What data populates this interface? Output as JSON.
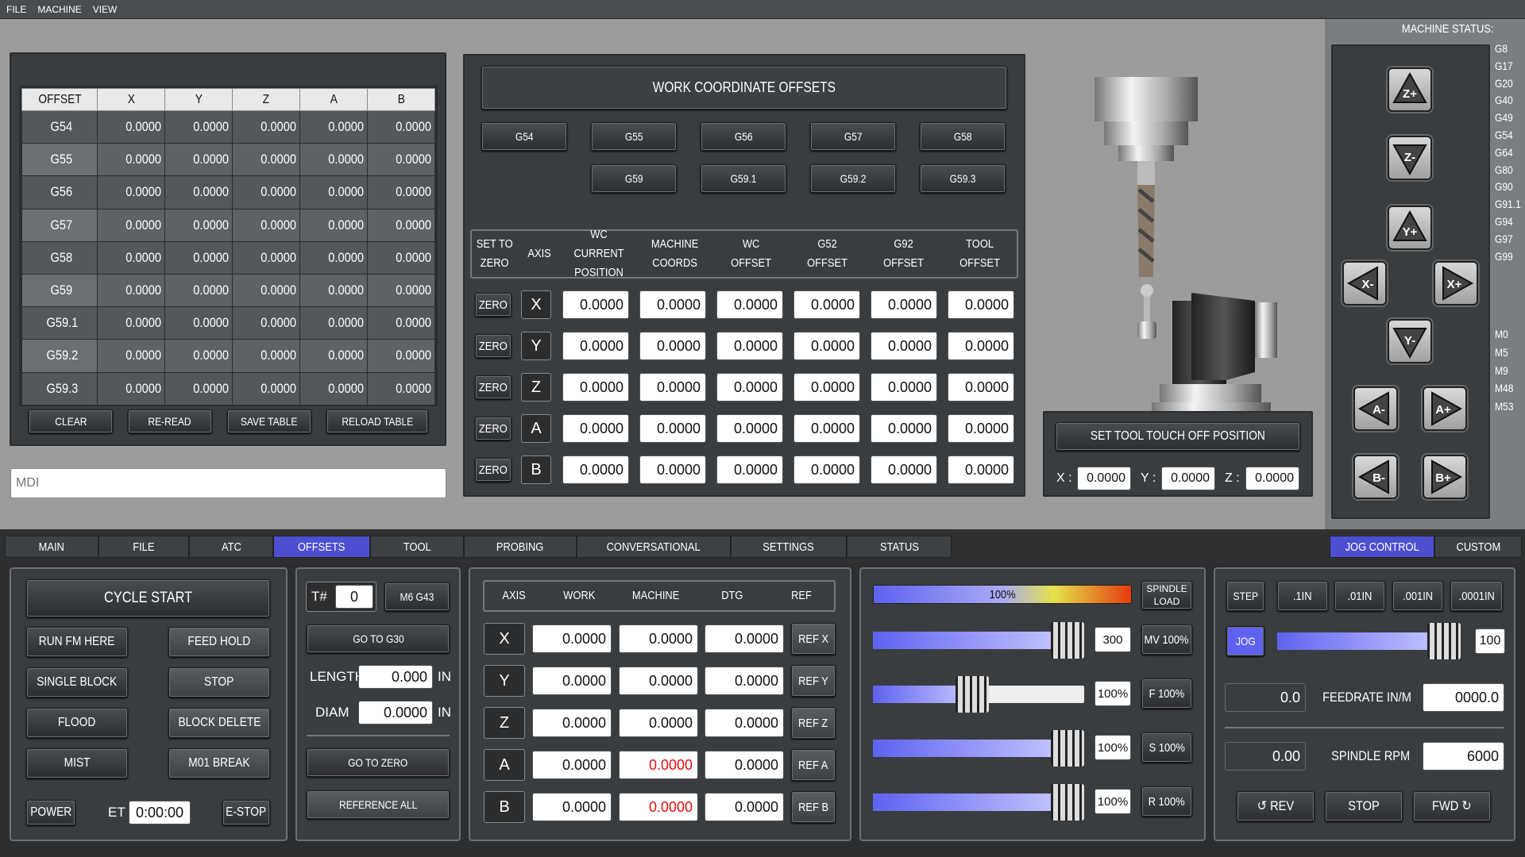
{
  "menu": [
    "FILE",
    "MACHINE",
    "VIEW"
  ],
  "offset_table": {
    "headers": [
      "OFFSET",
      "X",
      "Y",
      "Z",
      "A",
      "B"
    ],
    "rows": [
      [
        "G54",
        "0.0000",
        "0.0000",
        "0.0000",
        "0.0000",
        "0.0000"
      ],
      [
        "G55",
        "0.0000",
        "0.0000",
        "0.0000",
        "0.0000",
        "0.0000"
      ],
      [
        "G56",
        "0.0000",
        "0.0000",
        "0.0000",
        "0.0000",
        "0.0000"
      ],
      [
        "G57",
        "0.0000",
        "0.0000",
        "0.0000",
        "0.0000",
        "0.0000"
      ],
      [
        "G58",
        "0.0000",
        "0.0000",
        "0.0000",
        "0.0000",
        "0.0000"
      ],
      [
        "G59",
        "0.0000",
        "0.0000",
        "0.0000",
        "0.0000",
        "0.0000"
      ],
      [
        "G59.1",
        "0.0000",
        "0.0000",
        "0.0000",
        "0.0000",
        "0.0000"
      ],
      [
        "G59.2",
        "0.0000",
        "0.0000",
        "0.0000",
        "0.0000",
        "0.0000"
      ],
      [
        "G59.3",
        "0.0000",
        "0.0000",
        "0.0000",
        "0.0000",
        "0.0000"
      ]
    ],
    "buttons": [
      "CLEAR",
      "RE-READ",
      "SAVE TABLE",
      "RELOAD TABLE"
    ]
  },
  "mdi_placeholder": "MDI",
  "wco": {
    "title": "WORK COORDINATE OFFSETS",
    "row1": [
      "G54",
      "G55",
      "G56",
      "G57",
      "G58"
    ],
    "row2": [
      "G59",
      "G59.1",
      "G59.2",
      "G59.3"
    ],
    "headers": [
      "SET TO\nZERO",
      "AXIS",
      "WC CURRENT\nPOSITION",
      "MACHINE\nCOORDS",
      "WC\nOFFSET",
      "G52\nOFFSET",
      "G92\nOFFSET",
      "TOOL\nOFFSET"
    ],
    "zero_label": "ZERO",
    "axes": [
      "X",
      "Y",
      "Z",
      "A",
      "B"
    ],
    "value": "0.0000"
  },
  "touch_off": {
    "button": "SET TOOL TOUCH OFF POSITION",
    "x_label": "X :",
    "x": "0.0000",
    "y_label": "Y :",
    "y": "0.0000",
    "z_label": "Z :",
    "z": "0.0000"
  },
  "machine_status": {
    "label": "MACHINE STATUS:",
    "gcodes": [
      "G8",
      "G17",
      "G20",
      "G40",
      "G49",
      "G54",
      "G64",
      "G80",
      "G90",
      "G91.1",
      "G94",
      "G97",
      "G99"
    ],
    "mcodes": [
      "M0",
      "M5",
      "M9",
      "M48",
      "M53"
    ]
  },
  "jog_buttons": [
    "Z+",
    "Z-",
    "Y+",
    "X-",
    "X+",
    "Y-",
    "A-",
    "A+",
    "B-",
    "B+"
  ],
  "tabs": [
    "MAIN",
    "FILE",
    "ATC",
    "OFFSETS",
    "TOOL",
    "PROBING",
    "CONVERSATIONAL",
    "SETTINGS",
    "STATUS"
  ],
  "active_tab": "OFFSETS",
  "right_tabs": [
    "JOG CONTROL",
    "CUSTOM"
  ],
  "cycle": {
    "start": "CYCLE START",
    "buttons": [
      "RUN FM HERE",
      "FEED HOLD",
      "SINGLE BLOCK",
      "STOP",
      "FLOOD",
      "BLOCK DELETE",
      "MIST",
      "M01 BREAK"
    ],
    "power": "POWER",
    "et_label": "ET",
    "et": "0:00:00",
    "estop": "E-STOP"
  },
  "tool": {
    "t_label": "T#",
    "t_value": "0",
    "m6": "M6 G43",
    "goto_g30": "GO TO G30",
    "length_label": "LENGTH",
    "length": "0.000",
    "length_unit": "IN",
    "diam_label": "DIAM",
    "diam": "0.0000",
    "diam_unit": "IN",
    "goto_zero": "GO TO ZERO",
    "ref_all": "REFERENCE ALL"
  },
  "dro": {
    "headers": [
      "AXIS",
      "WORK",
      "MACHINE",
      "DTG",
      "REF"
    ],
    "rows": [
      {
        "axis": "X",
        "work": "0.0000",
        "machine": "0.0000",
        "dtg": "0.0000",
        "ref": "REF X",
        "red": false
      },
      {
        "axis": "Y",
        "work": "0.0000",
        "machine": "0.0000",
        "dtg": "0.0000",
        "ref": "REF Y",
        "red": false
      },
      {
        "axis": "Z",
        "work": "0.0000",
        "machine": "0.0000",
        "dtg": "0.0000",
        "ref": "REF Z",
        "red": false
      },
      {
        "axis": "A",
        "work": "0.0000",
        "machine": "0.0000",
        "dtg": "0.0000",
        "ref": "REF A",
        "red": true
      },
      {
        "axis": "B",
        "work": "0.0000",
        "machine": "0.0000",
        "dtg": "0.0000",
        "ref": "REF B",
        "red": true
      }
    ]
  },
  "overrides": {
    "load_text": "100%",
    "load_label": "SPINDLE\nLOAD",
    "sliders": [
      {
        "value": "300",
        "button": "MV 100%",
        "level": 0.92
      },
      {
        "value": "100%",
        "button": "F 100%",
        "level": 0.47
      },
      {
        "value": "100%",
        "button": "S 100%",
        "level": 0.92
      },
      {
        "value": "100%",
        "button": "R 100%",
        "level": 0.92
      }
    ]
  },
  "jog_ctl": {
    "step": "STEP",
    "increments": [
      ".1IN",
      ".01IN",
      ".001IN",
      ".0001IN"
    ],
    "jog": "JOG",
    "jog_value": "100",
    "jog_level": 0.92,
    "feed_actual": "0.0",
    "feed_label": "FEEDRATE IN/M",
    "feed_set": "0000.0",
    "rpm_actual": "0.00",
    "rpm_label": "SPINDLE RPM",
    "rpm_set": "6000",
    "rev": "↺ REV",
    "stop": "STOP",
    "fwd": "FWD ↻"
  },
  "colors": {
    "accent": "#4d4fd0",
    "red_value": "#e01010"
  }
}
